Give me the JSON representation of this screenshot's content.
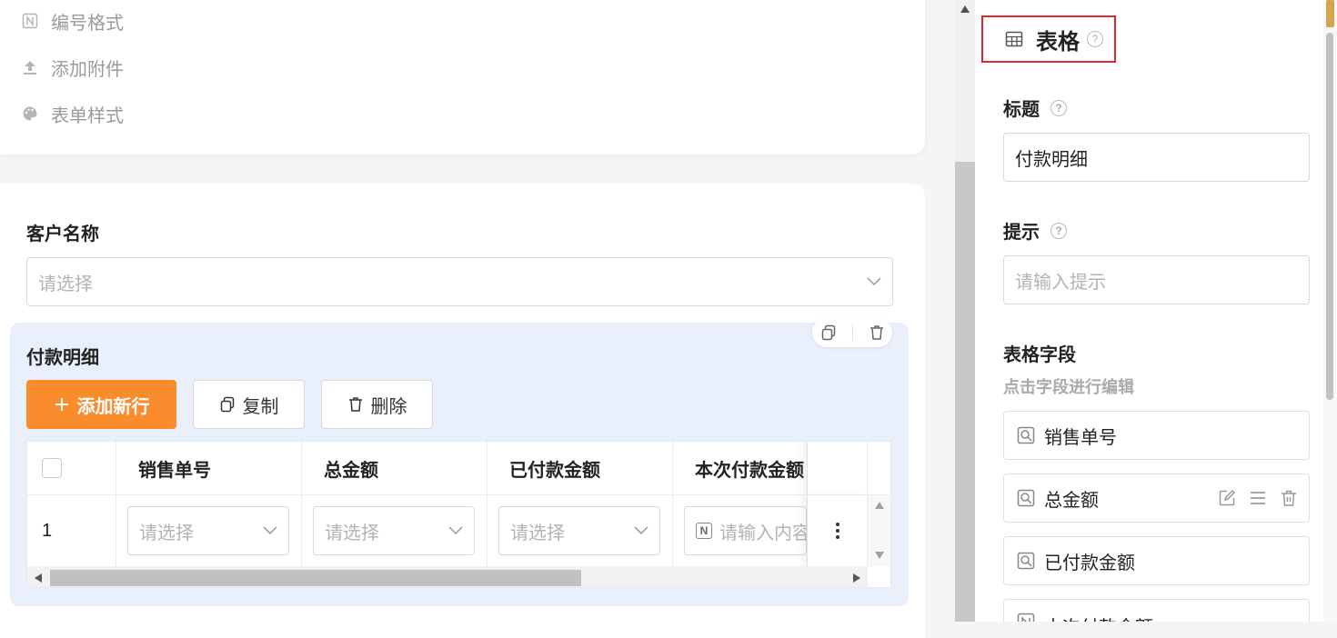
{
  "left_menu": [
    {
      "icon": "n-format-icon",
      "label": "编号格式"
    },
    {
      "icon": "upload-icon",
      "label": "添加附件"
    },
    {
      "icon": "palette-icon",
      "label": "表单样式"
    }
  ],
  "form": {
    "customer_label": "客户名称",
    "customer_placeholder": "请选择",
    "table_title": "付款明细",
    "buttons": {
      "add_row": "添加新行",
      "copy": "复制",
      "delete": "删除"
    },
    "columns": [
      "销售单号",
      "总金额",
      "已付款金额",
      "本次付款金额"
    ],
    "rows": [
      {
        "index": "1",
        "cells": [
          "请选择",
          "请选择",
          "请选择"
        ],
        "input_placeholder": "请输入内容"
      }
    ]
  },
  "panel": {
    "title": "表格",
    "title_label": "标题",
    "title_value": "付款明细",
    "hint_label": "提示",
    "hint_placeholder": "请输入提示",
    "fields_label": "表格字段",
    "fields_tip": "点击字段进行编辑",
    "fields": [
      "销售单号",
      "总金额",
      "已付款金额",
      "本次付款金额"
    ]
  },
  "colors": {
    "primary": "#fa8c2e",
    "highlight": "#e3262c",
    "table_bg": "#eaf0fb"
  }
}
